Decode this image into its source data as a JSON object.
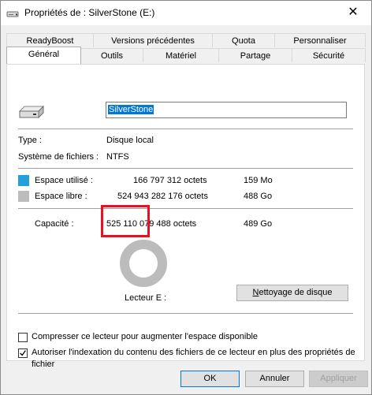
{
  "window": {
    "title": "Propriétés de : SilverStone (E:)",
    "close_glyph": "✕"
  },
  "tabs": {
    "row1": [
      "ReadyBoost",
      "Versions précédentes",
      "Quota",
      "Personnaliser"
    ],
    "row2": [
      "Général",
      "Outils",
      "Matériel",
      "Partage",
      "Sécurité"
    ],
    "active": "Général"
  },
  "general": {
    "drive_icon": "drive-icon",
    "name_value": "SilverStone",
    "type_label": "Type :",
    "type_value": "Disque local",
    "fs_label": "Système de fichiers :",
    "fs_value": "NTFS",
    "used_label": "Espace utilisé :",
    "used_bytes": "166 797 312 octets",
    "used_short": "159 Mo",
    "free_label": "Espace libre :",
    "free_bytes": "524 943 282 176 octets",
    "free_short": "488 Go",
    "capacity_label": "Capacité :",
    "capacity_bytes": "525 110 079 488 octets",
    "capacity_short": "489 Go",
    "drive_label": "Lecteur E :",
    "cleanup_button": "Nettoyage de disque",
    "used_fraction": 0.0003,
    "used_color": "#26a0da",
    "free_color": "#bcbcbc",
    "compress_label": "Compresser ce lecteur pour augmenter l'espace disponible",
    "compress_checked": false,
    "index_label_line1": "Autoriser l'indexation du contenu des fichiers de ce lecteur en plus des propriétés de",
    "index_label_line2": "fichier",
    "index_checked": true
  },
  "buttons": {
    "ok": "OK",
    "cancel": "Annuler",
    "apply": "Appliquer"
  }
}
